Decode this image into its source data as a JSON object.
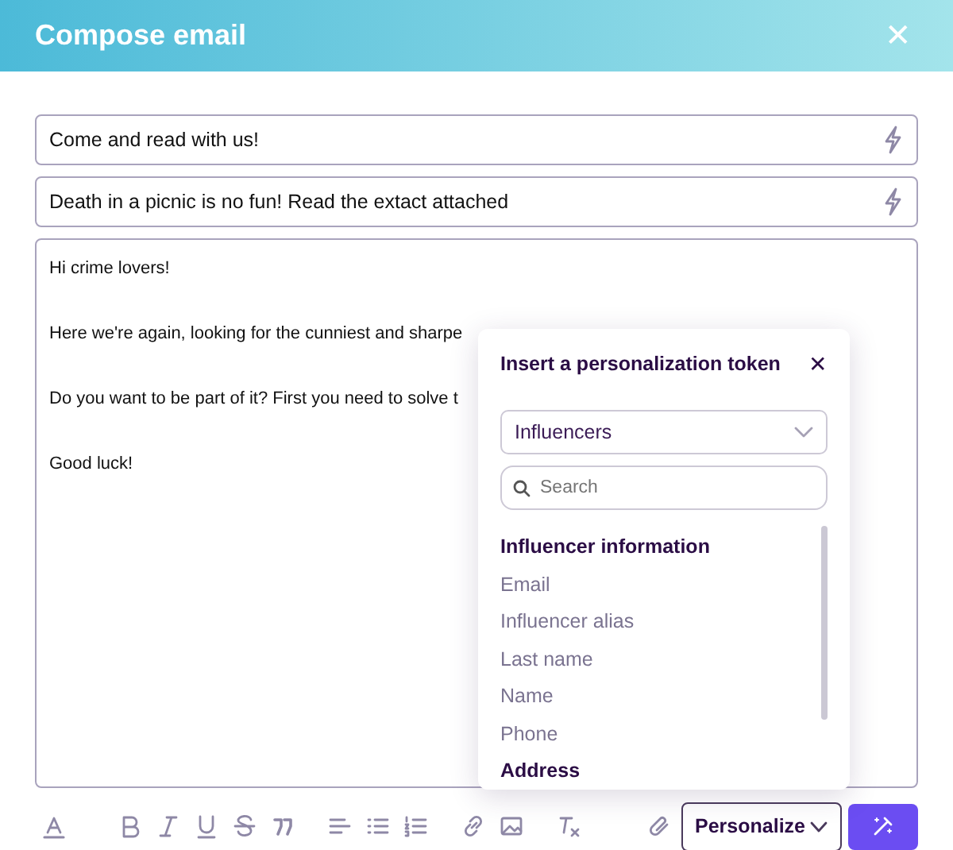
{
  "window": {
    "title": "Compose email",
    "close": "✕"
  },
  "fields": [
    {
      "value": "Come and read with us!"
    },
    {
      "value": "Death in a picnic is no fun! Read the extact attached"
    }
  ],
  "body": [
    "Hi crime lovers!",
    "Here we're again, looking for the cunniest and sharpe",
    "Do you want to be part of it? First you need to solve t",
    "Good luck!"
  ],
  "toolbar": [
    [
      {
        "kind": "text-color"
      }
    ],
    [
      {
        "kind": "bold"
      },
      {
        "kind": "italic"
      },
      {
        "kind": "underline"
      },
      {
        "kind": "strikethrough"
      },
      {
        "kind": "quote"
      }
    ],
    [
      {
        "kind": "align-left"
      },
      {
        "kind": "bullet-list"
      },
      {
        "kind": "numbered-list"
      }
    ],
    [
      {
        "kind": "link"
      },
      {
        "kind": "image"
      }
    ],
    [
      {
        "kind": "clear-format"
      }
    ]
  ],
  "right_tools": [
    {
      "kind": "attach"
    }
  ],
  "personalize": {
    "label": "Personalize"
  },
  "popover": {
    "title": "Insert a personalization token",
    "close": "✕",
    "select": "Influencers",
    "search": {
      "placeholder": "Search"
    },
    "items": [
      {
        "kind": "header",
        "label": "Influencer information"
      },
      {
        "kind": "item",
        "label": "Email"
      },
      {
        "kind": "item",
        "label": "Influencer alias"
      },
      {
        "kind": "item",
        "label": "Last name"
      },
      {
        "kind": "item",
        "label": "Name"
      },
      {
        "kind": "item",
        "label": "Phone"
      },
      {
        "kind": "header",
        "label": "Address"
      }
    ]
  }
}
